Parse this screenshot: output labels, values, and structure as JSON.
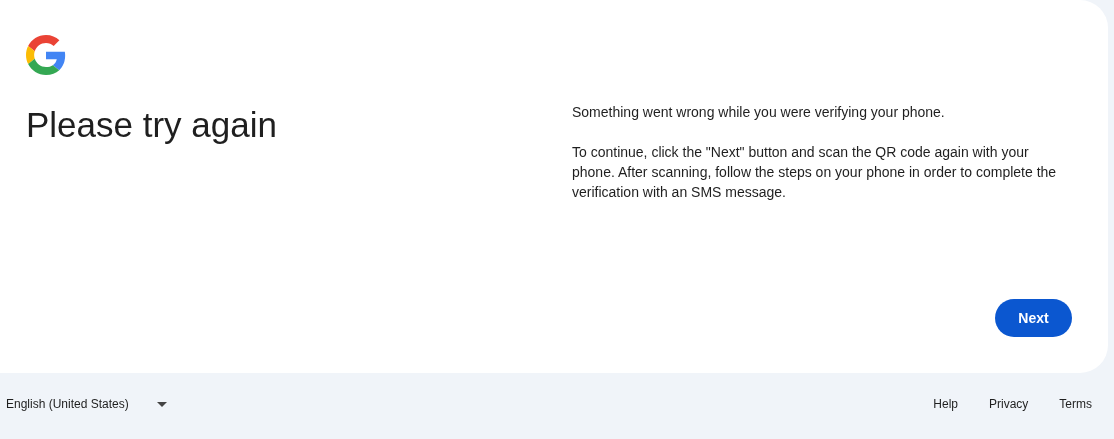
{
  "card": {
    "title": "Please try again",
    "paragraphs": [
      "Something went wrong while you were verifying your phone.",
      "To continue, click the \"Next\" button and scan the QR code again with your phone. After scanning, follow the steps on your phone in order to complete the verification with an SMS message."
    ],
    "button": "Next"
  },
  "footer": {
    "language": "English (United States)",
    "links": [
      "Help",
      "Privacy",
      "Terms"
    ]
  }
}
